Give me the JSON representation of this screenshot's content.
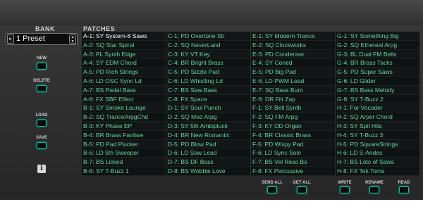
{
  "labels": {
    "bank": "BANK",
    "patches": "PATCHES"
  },
  "bank_select": {
    "value": "1 Preset",
    "arrow_icon": "▸",
    "up_icon": "▲",
    "down_icon": "▼"
  },
  "side_buttons": {
    "new": "NEW",
    "delete": "DELETE",
    "load": "LOAD",
    "save": "SAVE"
  },
  "info_icon": "i",
  "bottom_buttons": {
    "send_all": "SEND ALL",
    "get_all": "GET ALL",
    "write": "WRITE",
    "rename": "RENAME",
    "read": "READ"
  },
  "accent_color": "#00c8a0",
  "patch_text_color": "#63d49d",
  "selected_patch": "A-1",
  "patches": [
    {
      "slot": "A-1",
      "label": "A-1: SY System-8 Saws"
    },
    {
      "slot": "A-2",
      "label": "A-2: SQ Star Spiral"
    },
    {
      "slot": "A-3",
      "label": "A-3: PL Synth Edge"
    },
    {
      "slot": "A-4",
      "label": "A-4: SY EDM Chord"
    },
    {
      "slot": "A-5",
      "label": "A-5: PD Rich Strings"
    },
    {
      "slot": "A-6",
      "label": "A-6: LD OSC Sync Ld"
    },
    {
      "slot": "A-7",
      "label": "A-7: BS Pedal Bass"
    },
    {
      "slot": "A-8",
      "label": "A-8: FX SBF Effect"
    },
    {
      "slot": "B-1",
      "label": "B-1: SY Smoke Lounge"
    },
    {
      "slot": "B-2",
      "label": "B-2: SQ TranceArpgChd"
    },
    {
      "slot": "B-3",
      "label": "B-3: KY Phase EP"
    },
    {
      "slot": "B-4",
      "label": "B-4: BR Brass Fanfare"
    },
    {
      "slot": "B-5",
      "label": "B-5: PD Pad Plucker"
    },
    {
      "slot": "B-6",
      "label": "B-6: LD 5th Sweeper"
    },
    {
      "slot": "B-7",
      "label": "B-7: BS Licked"
    },
    {
      "slot": "B-8",
      "label": "B-8: SY T-Buzz 1"
    },
    {
      "slot": "C-1",
      "label": "C-1: PD Overtone Str"
    },
    {
      "slot": "C-2",
      "label": "C-2: SQ NeverLand"
    },
    {
      "slot": "C-3",
      "label": "C-3: KY VT Key"
    },
    {
      "slot": "C-4",
      "label": "C-4: BR Bright Brass"
    },
    {
      "slot": "C-5",
      "label": "C-5: PD Sizzle Pad"
    },
    {
      "slot": "C-6",
      "label": "C-6: LD Whistling Ld"
    },
    {
      "slot": "C-7",
      "label": "C-7: BS Saw Bass"
    },
    {
      "slot": "C-8",
      "label": "C-8: FX Space"
    },
    {
      "slot": "D-1",
      "label": "D-1: SY Soul Punch"
    },
    {
      "slot": "D-2",
      "label": "D-2: SQ Mod Arpg"
    },
    {
      "slot": "D-3",
      "label": "D-3: SY 5th Ambipluck"
    },
    {
      "slot": "D-4",
      "label": "D-4: BR New Romantic"
    },
    {
      "slot": "D-5",
      "label": "D-5: PD Blow Pad"
    },
    {
      "slot": "D-6",
      "label": "D-6: LD Saw Lead"
    },
    {
      "slot": "D-7",
      "label": "D-7: BS DF Bass"
    },
    {
      "slot": "D-8",
      "label": "D-8: BS Wobble Love"
    },
    {
      "slot": "E-1",
      "label": "E-1: SY Modern Trance"
    },
    {
      "slot": "E-2",
      "label": "E-2: SQ Clockworks"
    },
    {
      "slot": "E-3",
      "label": "E-3: PD Condenser"
    },
    {
      "slot": "E-4",
      "label": "E-4: SY Coned"
    },
    {
      "slot": "E-5",
      "label": "E-5: PD Big Pad"
    },
    {
      "slot": "E-6",
      "label": "E-6: LD PWM Lead"
    },
    {
      "slot": "E-7",
      "label": "E-7: SQ Bass Burn"
    },
    {
      "slot": "E-8",
      "label": "E-8: DR Filt Zap"
    },
    {
      "slot": "F-1",
      "label": "F-1: SY Bell Synth"
    },
    {
      "slot": "F-2",
      "label": "F-2: SQ FM Arpg"
    },
    {
      "slot": "F-3",
      "label": "F-3: KY OD Organ"
    },
    {
      "slot": "F-4",
      "label": "F-4: BR Classic Brass"
    },
    {
      "slot": "F-5",
      "label": "F-5: PD Wispy Pad"
    },
    {
      "slot": "F-6",
      "label": "F-6: LD Sync Solo"
    },
    {
      "slot": "F-7",
      "label": "F-7: BS Vel Reso Bs"
    },
    {
      "slot": "F-8",
      "label": "F-8: FX Percussive"
    },
    {
      "slot": "G-1",
      "label": "G-1: SY Something Big"
    },
    {
      "slot": "G-2",
      "label": "G-2: SQ Ethereal Arpg"
    },
    {
      "slot": "G-3",
      "label": "G-3: BL Dual FM Bells"
    },
    {
      "slot": "G-4",
      "label": "G-4: BR Brass Tacks"
    },
    {
      "slot": "G-5",
      "label": "G-5: PD Super Saws"
    },
    {
      "slot": "G-6",
      "label": "G-6: LD Glider"
    },
    {
      "slot": "G-7",
      "label": "G-7: BS Bass Melody"
    },
    {
      "slot": "G-8",
      "label": "G-8: SY T-Buzz 2"
    },
    {
      "slot": "H-1",
      "label": "H-1: For Vocoder"
    },
    {
      "slot": "H-2",
      "label": "H-2: SQ Arper Chord"
    },
    {
      "slot": "H-3",
      "label": "H-3: SY Spit Hits"
    },
    {
      "slot": "H-4",
      "label": "H-4: SY T-Buzz 3"
    },
    {
      "slot": "H-5",
      "label": "H-5: PD SquareStrings"
    },
    {
      "slot": "H-6",
      "label": "H-6: LD S-Andes"
    },
    {
      "slot": "H-7",
      "label": "H-7: BS Lots of Saws"
    },
    {
      "slot": "H-8",
      "label": "H-8: FX Tek Toms"
    }
  ]
}
